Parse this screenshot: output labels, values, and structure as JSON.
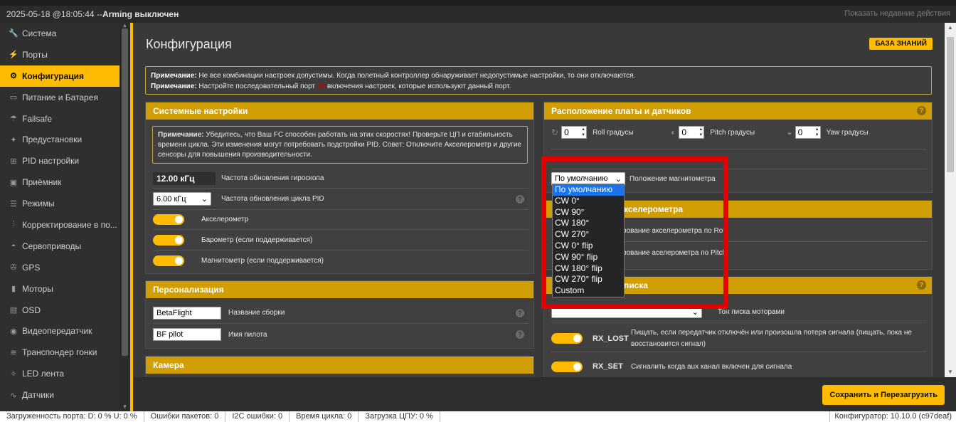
{
  "header": {
    "title_date": "2025-05-18 @18:05:44 -- ",
    "title_arming": "Arming выключен",
    "recent": "Показать недавние действия"
  },
  "sidebar": {
    "items": [
      {
        "label": "Система",
        "icon": "wrench-icon"
      },
      {
        "label": "Порты",
        "icon": "plug-icon"
      },
      {
        "label": "Конфигурация",
        "icon": "gear-icon"
      },
      {
        "label": "Питание и Батарея",
        "icon": "battery-icon"
      },
      {
        "label": "Failsafe",
        "icon": "parachute-icon"
      },
      {
        "label": "Предустановки",
        "icon": "magic-wand-icon"
      },
      {
        "label": "PID настройки",
        "icon": "hierarchy-icon"
      },
      {
        "label": "Приёмник",
        "icon": "receiver-icon"
      },
      {
        "label": "Режимы",
        "icon": "switches-icon"
      },
      {
        "label": "Корректирование в по...",
        "icon": "sliders-icon"
      },
      {
        "label": "Сервоприводы",
        "icon": "servo-icon"
      },
      {
        "label": "GPS",
        "icon": "satellite-icon"
      },
      {
        "label": "Моторы",
        "icon": "motor-icon"
      },
      {
        "label": "OSD",
        "icon": "osd-icon"
      },
      {
        "label": "Видеопередатчик",
        "icon": "broadcast-icon"
      },
      {
        "label": "Транспондер гонки",
        "icon": "transponder-icon"
      },
      {
        "label": "LED лента",
        "icon": "led-icon"
      },
      {
        "label": "Датчики",
        "icon": "pulse-icon"
      }
    ]
  },
  "main": {
    "title": "Конфигурация",
    "kb_button": "БАЗА ЗНАНИЙ",
    "note1_label": "Примечание:",
    "note1_text": " Не все комбинации настроек допустимы. Когда полетный контроллер обнаруживает недопустимые настройки, то они отключаются.",
    "note2_label": "Примечание:",
    "note2_text_a": " Настройте последовательный порт ",
    "note2_red": "до",
    "note2_text_b": " включения настроек, которые используют данный порт.",
    "save_button": "Сохранить и Перезагрузить"
  },
  "system_panel": {
    "title": "Системные настройки",
    "note_label": "Примечание:",
    "note_text": " Убедитесь, что Ваш FC способен работать на этих скоростях! Проверьте ЦП и стабильность времени цикла. Эти изменения могут потребовать подстройки PID. Совет: Отключите Акселерометр и другие сенсоры для повышения производительности.",
    "gyro_value": "12.00 кГц",
    "gyro_label": "Частота обновления гироскопа",
    "pid_value": "6.00 кГц",
    "pid_label": "Частота обновления цикла PID",
    "accel_label": "Акселерометр",
    "baro_label": "Барометр (если поддерживается)",
    "mag_label": "Магнитометр (если поддерживается)"
  },
  "personal_panel": {
    "title": "Персонализация",
    "build_value": "BetaFlight",
    "build_label": "Название сборки",
    "pilot_value": "BF pilot",
    "pilot_label": "Имя пилота"
  },
  "camera_panel": {
    "title": "Камера"
  },
  "board_panel": {
    "title": "Расположение платы и датчиков",
    "roll_value": "0",
    "roll_label": "Roll градусы",
    "pitch_value": "0",
    "pitch_label": "Pitch градусы",
    "yaw_value": "0",
    "yaw_label": "Yaw градусы",
    "mag_select": "По умолчанию",
    "mag_label": "Положение магнитометра"
  },
  "accel_panel": {
    "title_partial": "кселерометра",
    "roll_label": "рование акселерометра по Roll",
    "pitch_label": "рование аселерометра по Pitch"
  },
  "beeper_panel": {
    "title_partial": "писка",
    "motors_label": "Тон писка моторами",
    "rxlost_name": "RX_LOST",
    "rxlost_desc": "Пищать, если передатчик отключён или произошла потеря сигнала (пищать, пока не восстановится сигнал)",
    "rxset_name": "RX_SET",
    "rxset_desc": "Сигналить когда aux канал включен для сигнала"
  },
  "dropdown": {
    "options": [
      "По умолчанию",
      "CW 0°",
      "CW 90°",
      "CW 180°",
      "CW 270°",
      "CW 0° flip",
      "CW 90° flip",
      "CW 180° flip",
      "CW 270° flip",
      "Custom"
    ],
    "selected": "По умолчанию"
  },
  "status": {
    "port_load": "Загруженность порта: D: 0 % U: 0 %",
    "packet_errors": "Ошибки пакетов: 0",
    "i2c_errors": "I2C ошибки: 0",
    "cycle_time": "Время цикла: 0",
    "cpu_load": "Загрузка ЦПУ: 0 %",
    "configurator": "Конфигуратор: 10.10.0 (c97deaf)"
  },
  "colors": {
    "accent": "#ffbb00",
    "panel_header": "#d29e06",
    "highlight": "#e50000"
  }
}
